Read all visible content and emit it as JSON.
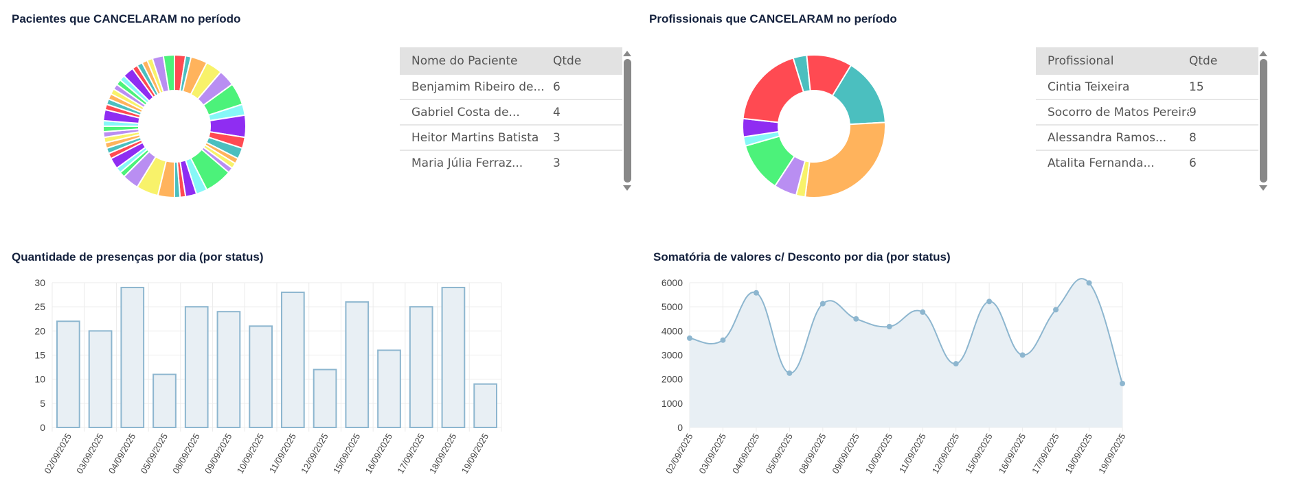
{
  "panels": {
    "patients_title": "Pacientes que CANCELARAM  no período",
    "professionals_title": "Profissionais que CANCELARAM no período",
    "presences_title": "Quantidade de presenças por dia (por status)",
    "values_title": "Somatória de valores c/ Desconto por dia (por status)"
  },
  "patients_table": {
    "headers": [
      "Nome do Paciente",
      "Qtde"
    ],
    "rows": [
      [
        "Benjamim Ribeiro de...",
        "6"
      ],
      [
        "Gabriel Costa de...",
        "4"
      ],
      [
        "Heitor Martins Batista",
        "3"
      ],
      [
        "Maria Júlia Ferraz...",
        "3"
      ]
    ]
  },
  "professionals_table": {
    "headers": [
      "Profissional",
      "Qtde"
    ],
    "rows": [
      [
        "Cintia Teixeira",
        "15"
      ],
      [
        "Socorro de Matos Pereira",
        "9"
      ],
      [
        "Alessandra Ramos...",
        "8"
      ],
      [
        "Atalita Fernanda...",
        "6"
      ]
    ]
  },
  "colors": {
    "palette": [
      "#ff4a52",
      "#4bbfbf",
      "#ffb35c",
      "#f8f26a",
      "#b98ef2",
      "#4cf27a",
      "#86f7f7",
      "#8f2df2"
    ],
    "bar_fill": "#e8eff4",
    "bar_stroke": "#8db6cf",
    "line_stroke": "#8db6cf",
    "area_fill": "#e8eff4",
    "grid": "#ebebeb"
  },
  "chart_data": [
    {
      "type": "pie",
      "variant": "donut",
      "title": "Pacientes que CANCELARAM  no período",
      "values": [
        2,
        1,
        3,
        3,
        3,
        4,
        2,
        4,
        2,
        2,
        1,
        1,
        1,
        5,
        2,
        2,
        1,
        1,
        3,
        4,
        3,
        1,
        1,
        2,
        1,
        1,
        1,
        1,
        1,
        1,
        1,
        2,
        1,
        1,
        1,
        1,
        1,
        1,
        1,
        2,
        1,
        1,
        1,
        1,
        2,
        2
      ],
      "colors": [
        "#ff4a52",
        "#4bbfbf",
        "#ffb35c",
        "#f8f26a",
        "#b98ef2",
        "#4cf27a",
        "#86f7f7",
        "#8f2df2",
        "#ff4a52",
        "#4bbfbf",
        "#ffb35c",
        "#f8f26a",
        "#b98ef2",
        "#4cf27a",
        "#86f7f7",
        "#8f2df2",
        "#ff4a52",
        "#4bbfbf",
        "#ffb35c",
        "#f8f26a",
        "#b98ef2",
        "#4cf27a",
        "#86f7f7",
        "#8f2df2",
        "#ff4a52",
        "#4bbfbf",
        "#ffb35c",
        "#f8f26a",
        "#b98ef2",
        "#4cf27a",
        "#86f7f7",
        "#8f2df2",
        "#ff4a52",
        "#4bbfbf",
        "#ffb35c",
        "#f8f26a",
        "#b98ef2",
        "#4cf27a",
        "#86f7f7",
        "#8f2df2",
        "#ff4a52",
        "#4bbfbf",
        "#ffb35c",
        "#f8f26a",
        "#b98ef2",
        "#4cf27a"
      ]
    },
    {
      "type": "pie",
      "variant": "donut",
      "title": "Profissionais que CANCELARAM no período",
      "values": [
        3,
        10,
        15,
        27,
        2,
        5,
        11,
        2,
        4,
        18
      ],
      "colors": [
        "#4bbfbf",
        "#ff4a52",
        "#4bbfbf",
        "#ffb35c",
        "#f8f26a",
        "#b98ef2",
        "#4cf27a",
        "#86f7f7",
        "#8f2df2",
        "#ff4a52"
      ]
    },
    {
      "type": "bar",
      "title": "Quantidade de presenças por dia (por status)",
      "categories": [
        "02/09/2025",
        "03/09/2025",
        "04/09/2025",
        "05/09/2025",
        "08/09/2025",
        "09/09/2025",
        "10/09/2025",
        "11/09/2025",
        "12/09/2025",
        "15/09/2025",
        "16/09/2025",
        "17/09/2025",
        "18/09/2025",
        "19/09/2025"
      ],
      "values": [
        22,
        20,
        29,
        11,
        25,
        24,
        21,
        28,
        12,
        26,
        16,
        25,
        29,
        9
      ],
      "ylim": [
        0,
        30
      ],
      "yticks": [
        0,
        5,
        10,
        15,
        20,
        25,
        30
      ],
      "grid": true
    },
    {
      "type": "area",
      "title": "Somatória de valores c/ Desconto por dia (por status)",
      "categories": [
        "02/09/2025",
        "03/09/2025",
        "04/09/2025",
        "05/09/2025",
        "08/09/2025",
        "09/09/2025",
        "10/09/2025",
        "11/09/2025",
        "12/09/2025",
        "15/09/2025",
        "16/09/2025",
        "17/09/2025",
        "18/09/2025",
        "19/09/2025"
      ],
      "values": [
        3700,
        3620,
        5580,
        2250,
        5130,
        4500,
        4180,
        4780,
        2640,
        5220,
        3000,
        4880,
        5990,
        1820
      ],
      "ylim": [
        0,
        6000
      ],
      "yticks": [
        0,
        1000,
        2000,
        3000,
        4000,
        5000,
        6000
      ],
      "grid": true,
      "smooth": true
    }
  ]
}
